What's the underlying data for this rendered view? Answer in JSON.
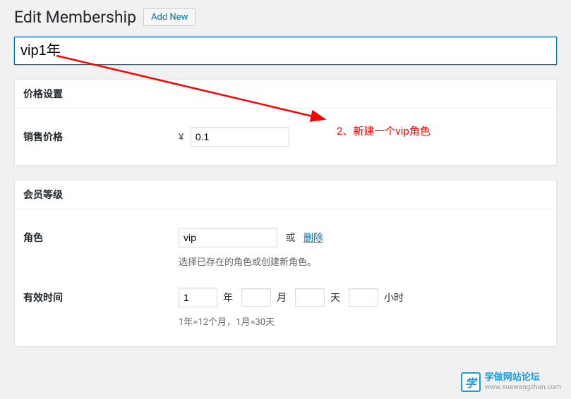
{
  "header": {
    "title": "Edit Membership",
    "add_new": "Add New"
  },
  "title_input": {
    "value": "vip1年"
  },
  "price_box": {
    "heading": "价格设置",
    "sale_price_label": "销售价格",
    "currency_symbol": "¥",
    "sale_price_value": "0.1"
  },
  "level_box": {
    "heading": "会员等级",
    "role_label": "角色",
    "role_value": "vip",
    "or_text": "或",
    "delete_text": "删除",
    "role_description": "选择已存在的角色或创建新角色。",
    "duration_label": "有效时间",
    "year_value": "1",
    "year_unit": "年",
    "month_value": "",
    "month_unit": "月",
    "day_value": "",
    "day_unit": "天",
    "hour_value": "",
    "hour_unit": "小时",
    "duration_description": "1年=12个月，1月=30天"
  },
  "annotation": {
    "text": "2、新建一个vip角色"
  },
  "watermark": {
    "icon_text": "学",
    "title": "学做网站论坛",
    "url": "www.xuewangzhan.com"
  }
}
